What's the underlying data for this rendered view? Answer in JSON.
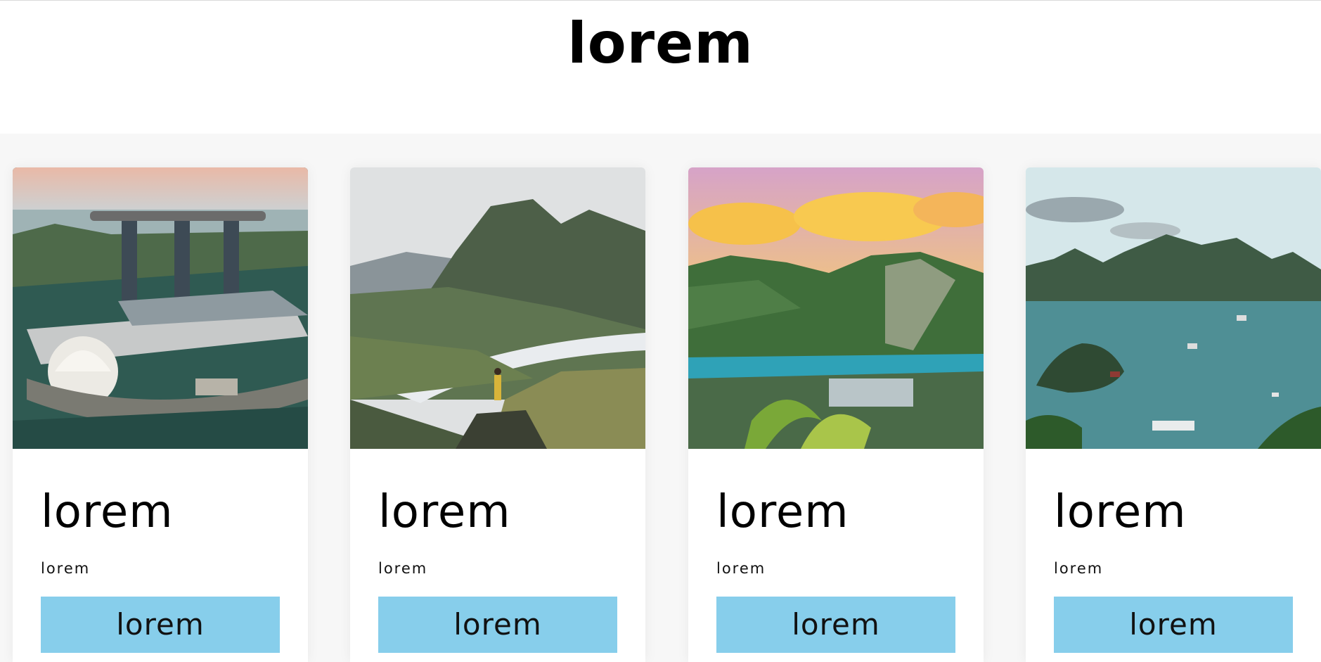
{
  "page": {
    "title": "lorem"
  },
  "cards": [
    {
      "title": "lorem",
      "subtitle": "lorem",
      "button_label": "lorem"
    },
    {
      "title": "lorem",
      "subtitle": "lorem",
      "button_label": "lorem"
    },
    {
      "title": "lorem",
      "subtitle": "lorem",
      "button_label": "lorem"
    },
    {
      "title": "lorem",
      "subtitle": "lorem",
      "button_label": "lorem"
    }
  ],
  "colors": {
    "button": "#87ceeb",
    "background": "#f7f7f7"
  }
}
